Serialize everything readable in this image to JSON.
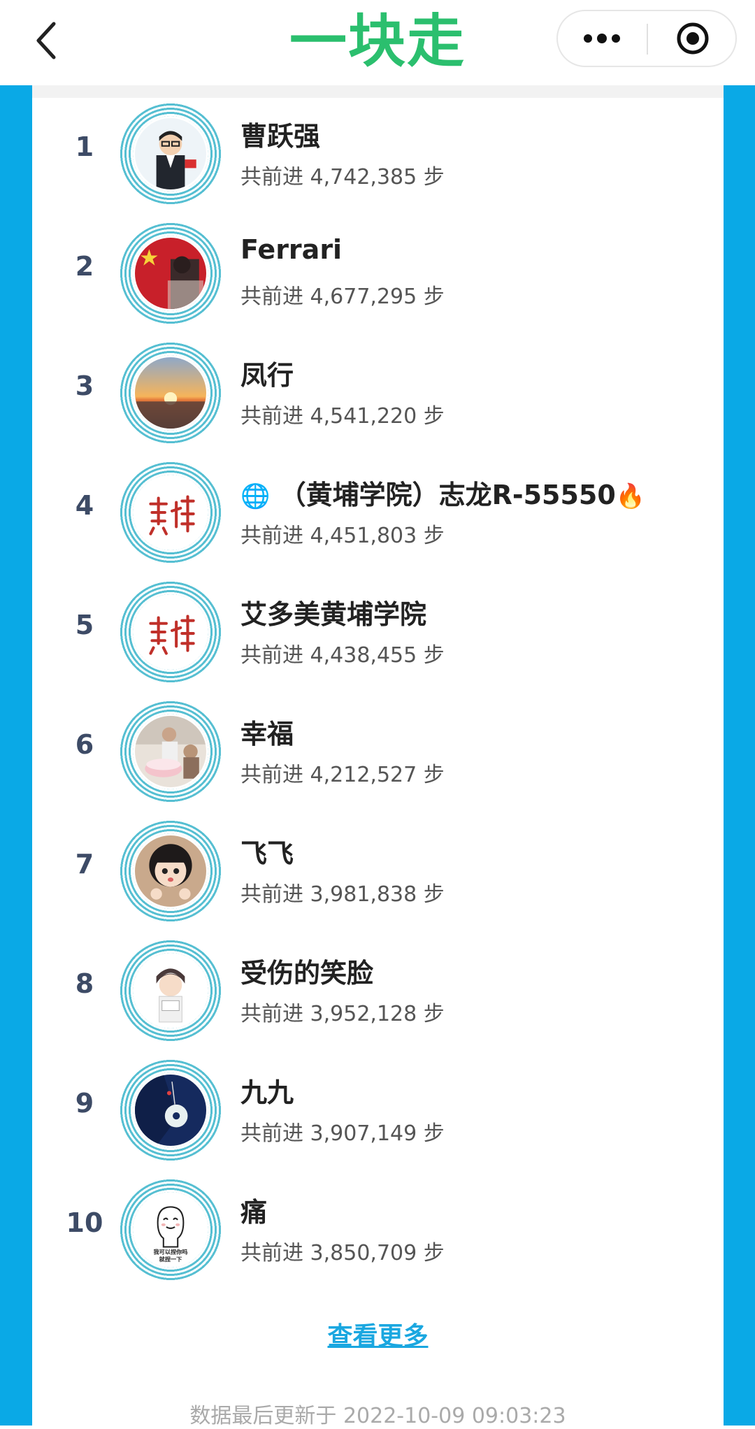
{
  "header": {
    "title": "一块走",
    "title_color": "#2bbf6e",
    "back_icon": "chevron-left-icon",
    "more_icon": "more-dots-icon",
    "close_icon": "target-circle-icon"
  },
  "theme": {
    "side_color": "#0aa9e6",
    "ring_color": "#56bfd2"
  },
  "leaderboard": [
    {
      "rank": "1",
      "name": "曹跃强",
      "steps": "共前进 4,742,385 步",
      "avatar": "cartoon-man-suit"
    },
    {
      "rank": "2",
      "name": "Ferrari",
      "steps": "共前进 4,677,295 步",
      "avatar": "flag-photo"
    },
    {
      "rank": "3",
      "name": "凤行",
      "steps": "共前进 4,541,220 步",
      "avatar": "sunset-sea"
    },
    {
      "rank": "4",
      "name": "（黄埔学院）志龙R-55550",
      "prefix_icon": "🌐",
      "suffix_icon": "🔥",
      "steps": "共前进 4,451,803 步",
      "avatar": "huangpu-calligraphy"
    },
    {
      "rank": "5",
      "name": "艾多美黄埔学院",
      "steps": "共前进 4,438,455 步",
      "avatar": "huangpu-calligraphy"
    },
    {
      "rank": "6",
      "name": "幸福",
      "steps": "共前进 4,212,527 步",
      "avatar": "birthday-cake-photo"
    },
    {
      "rank": "7",
      "name": "飞飞",
      "steps": "共前进 3,981,838 步",
      "avatar": "cartoon-girl"
    },
    {
      "rank": "8",
      "name": "受伤的笑脸",
      "steps": "共前进 3,952,128 步",
      "avatar": "cartoon-boy"
    },
    {
      "rank": "9",
      "name": "九九",
      "steps": "共前进 3,907,149 步",
      "avatar": "jade-pendant"
    },
    {
      "rank": "10",
      "name": "痛",
      "steps": "共前进 3,850,709 步",
      "avatar": "sticker-character",
      "avatar_text_1": "我可以捏你吗",
      "avatar_text_2": "就捏一下"
    }
  ],
  "footer": {
    "more_link": "查看更多",
    "updated": "数据最后更新于 2022-10-09 09:03:23"
  }
}
